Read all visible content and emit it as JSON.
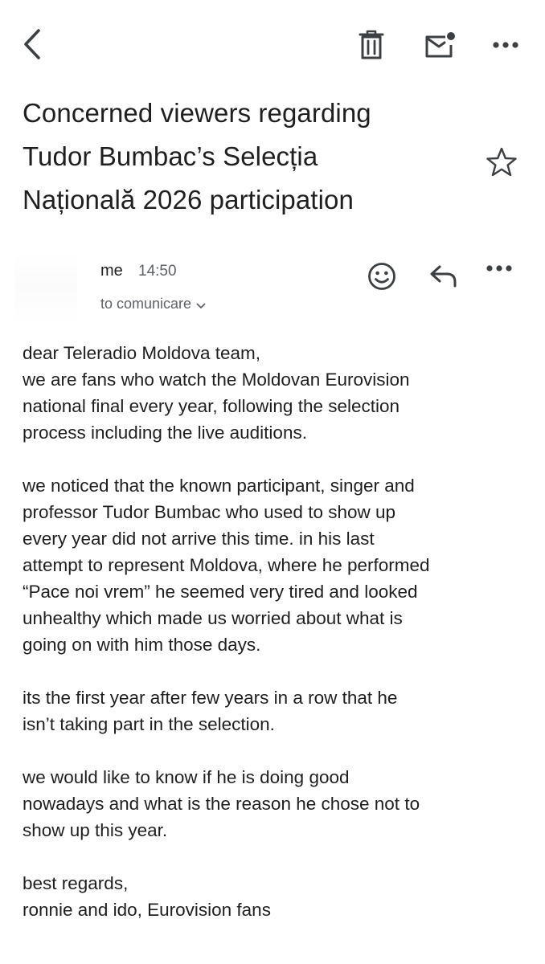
{
  "toolbar": {
    "back": {
      "icon": "chevron-left-icon"
    },
    "delete": {
      "icon": "trash-icon"
    },
    "mark_unread": {
      "icon": "mail-unread-icon"
    },
    "more": {
      "icon": "more-horizontal-icon"
    }
  },
  "subject": {
    "lines": [
      "Concerned viewers regarding",
      "Tudor Bumbac’s Selecția",
      "Națională 2026 participation"
    ],
    "star_icon": "star-outline-icon"
  },
  "message": {
    "sender": "me",
    "time": "14:50",
    "recipient": "to comunicare",
    "recipient_icon": "chevron-down-icon",
    "actions": {
      "react_icon": "smiley-icon",
      "reply_icon": "reply-icon",
      "more_icon": "more-horizontal-icon"
    }
  },
  "body": {
    "paragraphs": [
      [
        "dear Teleradio Moldova team,",
        "we are fans who watch the Moldovan Eurovision",
        "national final every year, following the selection",
        "process including the live auditions."
      ],
      [
        "we noticed that the known participant, singer and",
        "professor Tudor Bumbac who used to show up",
        "every year did not arrive this time. in his last",
        "attempt to represent Moldova, where he performed",
        "“Pace noi vrem” he seemed very tired and looked",
        "unhealthy which made us worried about what is",
        "going on with him those days."
      ],
      [
        "its the first year after few years in a row that he",
        "isn’t taking part in the selection."
      ],
      [
        "we would like to know if he is doing good",
        "nowadays and what is the reason he chose not to",
        "show up this year."
      ],
      [
        "best regards,",
        "ronnie and ido, Eurovision fans"
      ]
    ]
  },
  "colors": {
    "text": "#1f1f1f",
    "secondary": "#5f6368",
    "icon": "#3c4043"
  }
}
